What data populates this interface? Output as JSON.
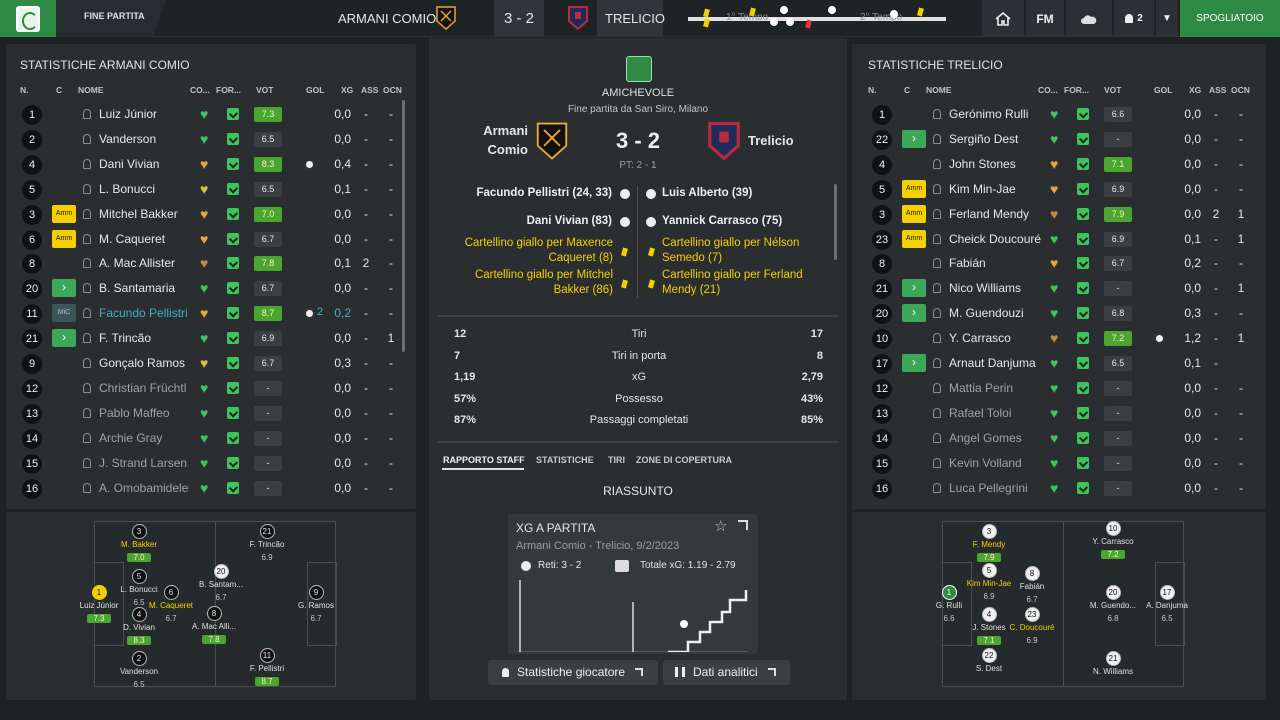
{
  "topbar": {
    "stage": "FINE PARTITA",
    "home": "ARMANI COMIO",
    "score": "3 - 2",
    "away": "TRELICIO",
    "t1": "1° Tempo",
    "t2": "2° Tempo",
    "fm": "FM",
    "people": "2",
    "locker": "SPOGLIATOIO"
  },
  "colors": {
    "accent": "#2e8b45",
    "rating_high": "#4aa531",
    "card": "#f5d000",
    "highlight": "#3fb0c2"
  },
  "left": {
    "title": "STATISTICHE ARMANI COMIO",
    "headers": {
      "n": "N.",
      "c": "C",
      "name": "NOME",
      "co": "CO...",
      "fo": "FOR...",
      "vot": "VOT",
      "gol": "GOL",
      "xg": "XG",
      "ass": "ASS",
      "ocn": "OCN"
    },
    "players": [
      {
        "n": "1",
        "tag": "",
        "name": "Luiz Júnior",
        "mood": "green",
        "vot": "7.3",
        "hi": true,
        "gol": "",
        "xg": "0,0",
        "ass": "-",
        "ocn": "-"
      },
      {
        "n": "2",
        "tag": "",
        "name": "Vanderson",
        "mood": "green",
        "vot": "6.5",
        "hi": false,
        "gol": "",
        "xg": "0,0",
        "ass": "-",
        "ocn": "-"
      },
      {
        "n": "4",
        "tag": "",
        "name": "Dani Vivian",
        "mood": "orange",
        "vot": "8.3",
        "hi": true,
        "gol": "ball",
        "xg": "0,4",
        "ass": "-",
        "ocn": "-"
      },
      {
        "n": "5",
        "tag": "",
        "name": "L. Bonucci",
        "mood": "yellow",
        "vot": "6.5",
        "hi": false,
        "gol": "",
        "xg": "0,1",
        "ass": "-",
        "ocn": "-"
      },
      {
        "n": "3",
        "tag": "Amm",
        "name": "Mitchel Bakker",
        "mood": "orange",
        "vot": "7.0",
        "hi": true,
        "gol": "",
        "xg": "0,0",
        "ass": "-",
        "ocn": "-"
      },
      {
        "n": "6",
        "tag": "Amm",
        "name": "M. Caqueret",
        "mood": "orange",
        "vot": "6.7",
        "hi": false,
        "gol": "",
        "xg": "0,0",
        "ass": "-",
        "ocn": "-"
      },
      {
        "n": "8",
        "tag": "",
        "name": "A. Mac Allister",
        "mood": "brown",
        "vot": "7.8",
        "hi": true,
        "gol": "",
        "xg": "0,1",
        "ass": "2",
        "ocn": "-"
      },
      {
        "n": "20",
        "tag": "sub",
        "name": "B. Santamaria",
        "mood": "green",
        "vot": "6.7",
        "hi": false,
        "gol": "",
        "xg": "0,0",
        "ass": "-",
        "ocn": "-"
      },
      {
        "n": "11",
        "tag": "MiC",
        "name": "Facundo Pellistri",
        "mood": "orange",
        "vot": "8.7",
        "hi": true,
        "gol": "ball2",
        "goals": "2",
        "xg": "0,2",
        "ass": "-",
        "ocn": "-",
        "highlight": true
      },
      {
        "n": "21",
        "tag": "sub",
        "name": "F. Trincão",
        "mood": "green",
        "vot": "6.9",
        "hi": false,
        "gol": "",
        "xg": "0,0",
        "ass": "-",
        "ocn": "1"
      },
      {
        "n": "9",
        "tag": "",
        "name": "Gonçalo Ramos",
        "mood": "yellow",
        "vot": "6.7",
        "hi": false,
        "gol": "",
        "xg": "0,3",
        "ass": "-",
        "ocn": "-"
      },
      {
        "n": "12",
        "tag": "",
        "name": "Christian Früchtl",
        "mood": "green",
        "vot": "-",
        "hi": false,
        "gol": "",
        "xg": "0,0",
        "ass": "-",
        "ocn": "-",
        "dim": true
      },
      {
        "n": "13",
        "tag": "",
        "name": "Pablo Maffeo",
        "mood": "green",
        "vot": "-",
        "hi": false,
        "gol": "",
        "xg": "0,0",
        "ass": "-",
        "ocn": "-",
        "dim": true
      },
      {
        "n": "14",
        "tag": "",
        "name": "Archie Gray",
        "mood": "green",
        "vot": "-",
        "hi": false,
        "gol": "",
        "xg": "0,0",
        "ass": "-",
        "ocn": "-",
        "dim": true
      },
      {
        "n": "15",
        "tag": "",
        "name": "J. Strand Larsen",
        "mood": "green",
        "vot": "-",
        "hi": false,
        "gol": "",
        "xg": "0,0",
        "ass": "-",
        "ocn": "-",
        "dim": true
      },
      {
        "n": "16",
        "tag": "",
        "name": "A. Omobamidele",
        "mood": "green",
        "vot": "-",
        "hi": false,
        "gol": "",
        "xg": "0,0",
        "ass": "-",
        "ocn": "-",
        "dim": true
      }
    ],
    "pitch": [
      {
        "n": "1",
        "name": "Luiz Júnior",
        "rt": "7.3",
        "hi": true,
        "style": "y",
        "ny": false
      },
      {
        "n": "2",
        "name": "Vanderson",
        "rt": "6.5",
        "hi": false,
        "style": "",
        "ny": false
      },
      {
        "n": "4",
        "name": "D. Vivian",
        "rt": "8.3",
        "hi": true,
        "style": "",
        "ny": false
      },
      {
        "n": "5",
        "name": "L. Bonucci",
        "rt": "6.5",
        "hi": false,
        "style": "",
        "ny": false
      },
      {
        "n": "3",
        "name": "M. Bakker",
        "rt": "7.0",
        "hi": true,
        "style": "",
        "ny": true
      },
      {
        "n": "6",
        "name": "M. Caqueret",
        "rt": "6.7",
        "hi": false,
        "style": "",
        "ny": true
      },
      {
        "n": "8",
        "name": "A. Mac Alli...",
        "rt": "7.8",
        "hi": true,
        "style": "",
        "ny": false
      },
      {
        "n": "20",
        "name": "B. Santam...",
        "rt": "6.7",
        "hi": false,
        "style": "w",
        "ny": false
      },
      {
        "n": "11",
        "name": "F. Pellistri",
        "rt": "8.7",
        "hi": true,
        "style": "",
        "ny": false
      },
      {
        "n": "21",
        "name": "F. Trincão",
        "rt": "6.9",
        "hi": false,
        "style": "",
        "ny": false
      },
      {
        "n": "9",
        "name": "G. Ramos",
        "rt": "6.7",
        "hi": false,
        "style": "",
        "ny": false
      }
    ]
  },
  "center": {
    "competition": "AMICHEVOLE",
    "subtitle": "Fine partita da San Siro, Milano",
    "home": "Armani\nComio",
    "home1": "Armani",
    "home2": "Comio",
    "score": "3 - 2",
    "ht": "PT: 2 - 1",
    "away": "Trelicio",
    "home_events": [
      {
        "t": "Facundo Pellistri (24, 33)",
        "k": "goal"
      },
      {
        "t": "Dani Vivian (83)",
        "k": "goal"
      },
      {
        "t": "Cartellino giallo per Maxence Caqueret (8)",
        "k": "card"
      },
      {
        "t": "Cartellino giallo per Mitchel Bakker (86)",
        "k": "card"
      }
    ],
    "away_events": [
      {
        "t": "Luis Alberto (39)",
        "k": "goal"
      },
      {
        "t": "Yannick Carrasco (75)",
        "k": "goal"
      },
      {
        "t": "Cartellino giallo per Nélson Semedo (7)",
        "k": "card"
      },
      {
        "t": "Cartellino giallo per Ferland Mendy (21)",
        "k": "card"
      }
    ],
    "stats": [
      {
        "h": "12",
        "l": "Tiri",
        "a": "17"
      },
      {
        "h": "7",
        "l": "Tiri in porta",
        "a": "8"
      },
      {
        "h": "1,19",
        "l": "xG",
        "a": "2,79"
      },
      {
        "h": "57%",
        "l": "Possesso",
        "a": "43%"
      },
      {
        "h": "87%",
        "l": "Passaggi completati",
        "a": "85%"
      }
    ],
    "tabs": [
      "RAPPORTO STAFF",
      "STATISTICHE",
      "TIRI",
      "ZONE DI COPERTURA"
    ],
    "summary": "RIASSUNTO",
    "xg_card": {
      "title": "XG A PARTITA",
      "sub": "Armani Comio - Trelicio, 9/2/2023",
      "goals": "Reti: 3 - 2",
      "xg": "Totale xG: 1.19 - 2.79"
    },
    "btn1": "Statistiche giocatore",
    "btn2": "Dati analitici"
  },
  "right": {
    "title": "STATISTICHE TRELICIO",
    "players": [
      {
        "n": "1",
        "tag": "",
        "name": "Gerónimo Rulli",
        "mood": "green",
        "vot": "6.6",
        "hi": false,
        "gol": "",
        "xg": "0,0",
        "ass": "-",
        "ocn": "-"
      },
      {
        "n": "22",
        "tag": "sub",
        "name": "Sergiño Dest",
        "mood": "green",
        "vot": "-",
        "hi": false,
        "gol": "",
        "xg": "0,0",
        "ass": "-",
        "ocn": "-"
      },
      {
        "n": "4",
        "tag": "",
        "name": "John Stones",
        "mood": "orange",
        "vot": "7.1",
        "hi": true,
        "gol": "",
        "xg": "0,0",
        "ass": "-",
        "ocn": "-"
      },
      {
        "n": "5",
        "tag": "Amm",
        "name": "Kim Min-Jae",
        "mood": "orange",
        "vot": "6.9",
        "hi": false,
        "gol": "",
        "xg": "0,0",
        "ass": "-",
        "ocn": "-"
      },
      {
        "n": "3",
        "tag": "Amm",
        "name": "Ferland Mendy",
        "mood": "brown",
        "vot": "7.9",
        "hi": true,
        "gol": "",
        "xg": "0,0",
        "ass": "2",
        "ocn": "1"
      },
      {
        "n": "23",
        "tag": "Amm",
        "name": "Cheick Doucouré",
        "mood": "green",
        "vot": "6.9",
        "hi": false,
        "gol": "",
        "xg": "0,1",
        "ass": "-",
        "ocn": "1"
      },
      {
        "n": "8",
        "tag": "",
        "name": "Fabián",
        "mood": "orange",
        "vot": "6.7",
        "hi": false,
        "gol": "",
        "xg": "0,2",
        "ass": "-",
        "ocn": "-"
      },
      {
        "n": "21",
        "tag": "sub",
        "name": "Nico Williams",
        "mood": "green",
        "vot": "-",
        "hi": false,
        "gol": "",
        "xg": "0,0",
        "ass": "-",
        "ocn": "1"
      },
      {
        "n": "20",
        "tag": "sub",
        "name": "M. Guendouzi",
        "mood": "green",
        "vot": "6.8",
        "hi": false,
        "gol": "",
        "xg": "0,3",
        "ass": "-",
        "ocn": "-"
      },
      {
        "n": "10",
        "tag": "",
        "name": "Y. Carrasco",
        "mood": "brown",
        "vot": "7.2",
        "hi": true,
        "gol": "ball",
        "xg": "1,2",
        "ass": "-",
        "ocn": "1"
      },
      {
        "n": "17",
        "tag": "sub",
        "name": "Arnaut Danjuma",
        "mood": "green",
        "vot": "6.5",
        "hi": false,
        "gol": "",
        "xg": "0,1",
        "ass": "-",
        "ocn": ""
      },
      {
        "n": "12",
        "tag": "",
        "name": "Mattia Perin",
        "mood": "green",
        "vot": "-",
        "hi": false,
        "gol": "",
        "xg": "0,0",
        "ass": "-",
        "ocn": "-",
        "dim": true
      },
      {
        "n": "13",
        "tag": "",
        "name": "Rafael Toloi",
        "mood": "green",
        "vot": "-",
        "hi": false,
        "gol": "",
        "xg": "0,0",
        "ass": "-",
        "ocn": "-",
        "dim": true
      },
      {
        "n": "14",
        "tag": "",
        "name": "Angel Gomes",
        "mood": "green",
        "vot": "-",
        "hi": false,
        "gol": "",
        "xg": "0,0",
        "ass": "-",
        "ocn": "-",
        "dim": true
      },
      {
        "n": "15",
        "tag": "",
        "name": "Kevin Volland",
        "mood": "green",
        "vot": "-",
        "hi": false,
        "gol": "",
        "xg": "0,0",
        "ass": "-",
        "ocn": "-",
        "dim": true
      },
      {
        "n": "16",
        "tag": "",
        "name": "Luca Pellegrini",
        "mood": "green",
        "vot": "-",
        "hi": false,
        "gol": "",
        "xg": "0,0",
        "ass": "-",
        "ocn": "-",
        "dim": true
      }
    ],
    "pitch": [
      {
        "n": "1",
        "name": "G. Rulli",
        "rt": "6.6",
        "hi": false,
        "style": "g",
        "ny": false
      },
      {
        "n": "3",
        "name": "F. Mendy",
        "rt": "7.9",
        "hi": true,
        "style": "w",
        "ny": true
      },
      {
        "n": "5",
        "name": "Kim Min-Jae",
        "rt": "6.9",
        "hi": false,
        "style": "w",
        "ny": true
      },
      {
        "n": "4",
        "name": "J. Stones",
        "rt": "7.1",
        "hi": true,
        "style": "w",
        "ny": false
      },
      {
        "n": "22",
        "name": "S. Dest",
        "rt": "",
        "hi": false,
        "style": "w",
        "ny": false
      },
      {
        "n": "8",
        "name": "Fabián",
        "rt": "6.7",
        "hi": false,
        "style": "w",
        "ny": false
      },
      {
        "n": "23",
        "name": "C. Doucouré",
        "rt": "6.9",
        "hi": false,
        "style": "w",
        "ny": true
      },
      {
        "n": "10",
        "name": "Y. Carrasco",
        "rt": "7.2",
        "hi": true,
        "style": "w",
        "ny": false
      },
      {
        "n": "20",
        "name": "M. Guendo...",
        "rt": "6.8",
        "hi": false,
        "style": "w",
        "ny": false
      },
      {
        "n": "21",
        "name": "N. Williams",
        "rt": "",
        "hi": false,
        "style": "w",
        "ny": false
      },
      {
        "n": "17",
        "name": "A. Danjuma",
        "rt": "6.5",
        "hi": false,
        "style": "w",
        "ny": false
      }
    ]
  }
}
